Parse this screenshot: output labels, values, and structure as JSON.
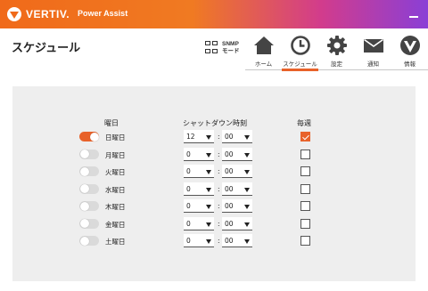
{
  "header": {
    "brand": "VERTIV.",
    "app_name": "Power Assist"
  },
  "page": {
    "title": "スケジュール"
  },
  "snmp": {
    "line1": "SNMP",
    "line2": "モード"
  },
  "nav": {
    "items": [
      {
        "label": "ホーム",
        "icon": "home-icon"
      },
      {
        "label": "スケジュール",
        "icon": "clock-icon",
        "active": true
      },
      {
        "label": "設定",
        "icon": "gear-icon"
      },
      {
        "label": "通知",
        "icon": "envelope-icon"
      },
      {
        "label": "情報",
        "icon": "vertiv-v-icon"
      }
    ]
  },
  "schedule": {
    "headers": {
      "day": "曜日",
      "shutdown_time": "シャットダウン時刻",
      "weekly": "毎週"
    },
    "rows": [
      {
        "day": "日曜日",
        "enabled": true,
        "hour": "12",
        "minute": "00",
        "weekly": true
      },
      {
        "day": "月曜日",
        "enabled": false,
        "hour": "0",
        "minute": "00",
        "weekly": false
      },
      {
        "day": "火曜日",
        "enabled": false,
        "hour": "0",
        "minute": "00",
        "weekly": false
      },
      {
        "day": "水曜日",
        "enabled": false,
        "hour": "0",
        "minute": "00",
        "weekly": false
      },
      {
        "day": "木曜日",
        "enabled": false,
        "hour": "0",
        "minute": "00",
        "weekly": false
      },
      {
        "day": "金曜日",
        "enabled": false,
        "hour": "0",
        "minute": "00",
        "weekly": false
      },
      {
        "day": "土曜日",
        "enabled": false,
        "hour": "0",
        "minute": "00",
        "weekly": false
      }
    ],
    "separator": ":"
  },
  "colors": {
    "accent": "#e8622a",
    "panel": "#eeeeee",
    "header_start": "#f06a1a",
    "header_end": "#8a3fd6"
  }
}
